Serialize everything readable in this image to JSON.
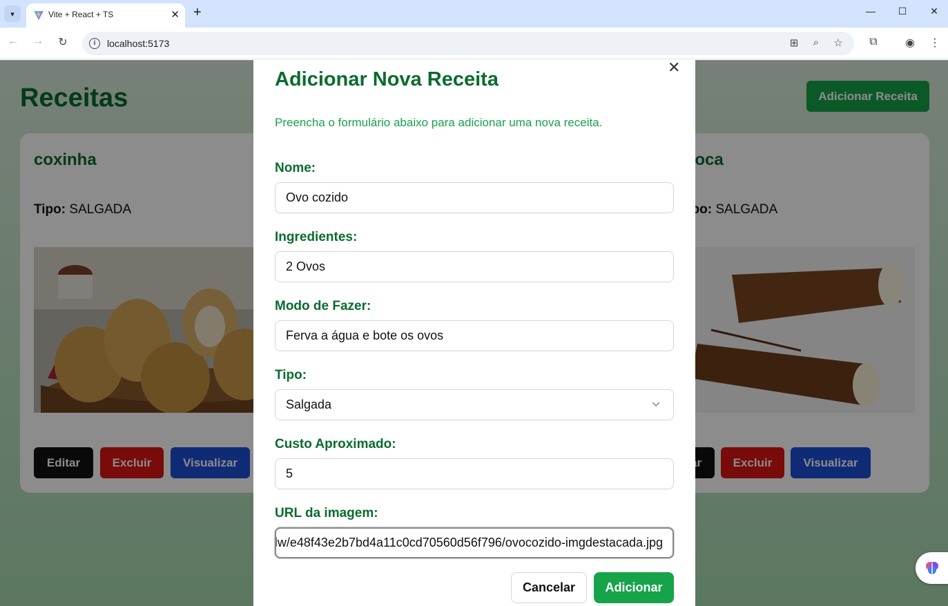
{
  "browser": {
    "tab_title": "Vite + React + TS",
    "url": "localhost:5173"
  },
  "page": {
    "title": "Receitas",
    "add_button": "Adicionar Receita",
    "cards": [
      {
        "name": "coxinha",
        "type_label": "Tipo:",
        "type_value": "SALGADA",
        "buttons": {
          "edit": "Editar",
          "delete": "Excluir",
          "view": "Visualizar"
        }
      },
      {
        "name": "dioca",
        "type_label": "Tipo:",
        "type_value": "SALGADA",
        "buttons": {
          "edit": "Editar",
          "delete": "Excluir",
          "view": "Visualizar"
        }
      }
    ]
  },
  "modal": {
    "title": "Adicionar Nova Receita",
    "description": "Preencha o formulário abaixo para adicionar uma nova receita.",
    "fields": {
      "name": {
        "label": "Nome:",
        "value": "Ovo cozido"
      },
      "ingredients": {
        "label": "Ingredientes:",
        "value": "2 Ovos"
      },
      "method": {
        "label": "Modo de Fazer:",
        "value": "Ferva a água e bote os ovos"
      },
      "type": {
        "label": "Tipo:",
        "value": "Salgada"
      },
      "cost": {
        "label": "Custo Aproximado:",
        "value": "5"
      },
      "image_url": {
        "label": "URL da imagem:",
        "value": "lw/e48f43e2b7bd4a11c0cd70560d56f796/ovocozido-imgdestacada.jpg"
      }
    },
    "cancel_button": "Cancelar",
    "submit_button": "Adicionar"
  },
  "colors": {
    "brand_dark_green": "#0a6b2e",
    "brand_green": "#16a34a",
    "delete_red": "#dc1414",
    "view_blue": "#1e4fd8"
  }
}
